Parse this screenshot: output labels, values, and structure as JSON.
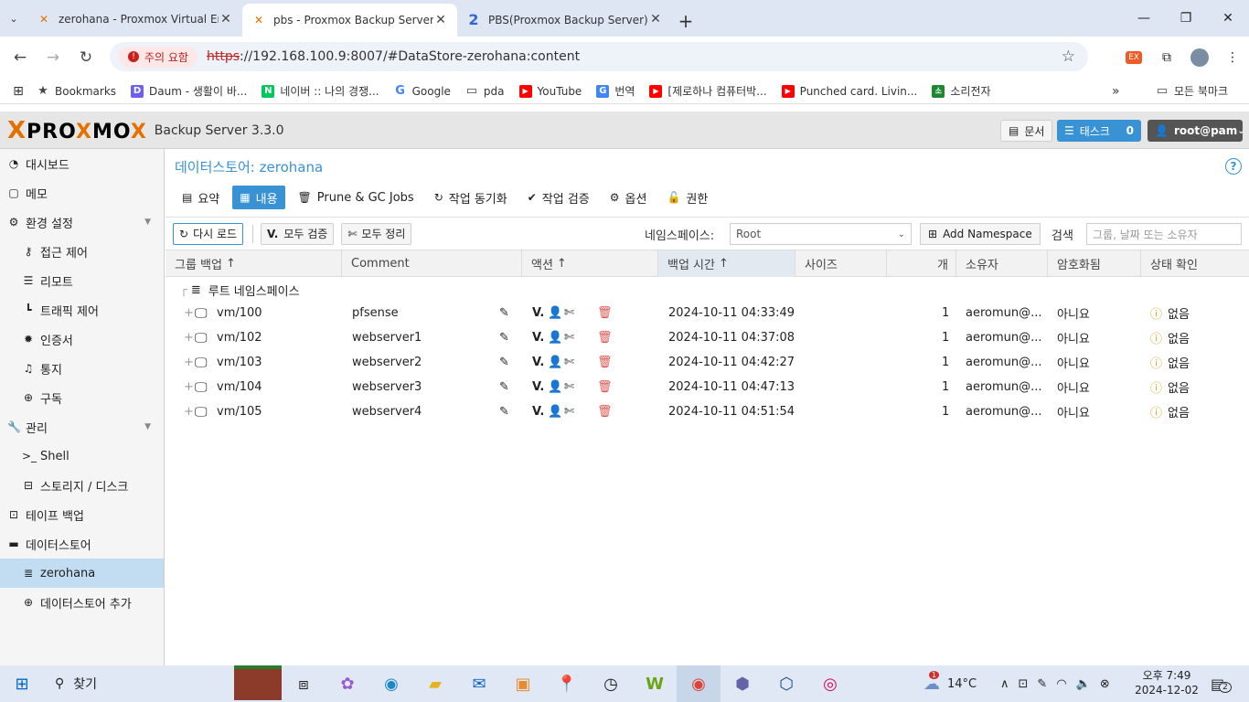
{
  "browser": {
    "tabs": [
      {
        "title": "zerohana - Proxmox Virtual En",
        "active": false
      },
      {
        "title": "pbs - Proxmox Backup Server",
        "active": true
      },
      {
        "title": "PBS(Proxmox Backup Server) 설",
        "active": false
      }
    ],
    "security_warning": "주의 요함",
    "url_scheme": "https",
    "url_rest": "://192.168.100.9:8007/#DataStore-zerohana:content",
    "bookmarks": [
      "Bookmarks",
      "Daum - 생활이 바...",
      "네이버 :: 나의 경쟁...",
      "Google",
      "pda",
      "YouTube",
      "번역",
      "[제로하나 컴퓨터박...",
      "Punched card. Livin...",
      "소리전자"
    ],
    "all_bookmarks": "모든 북마크"
  },
  "app": {
    "logo_left": "PRO",
    "logo_x": "X",
    "logo_mid": "MO",
    "logo_x2": "X",
    "product": "Backup Server 3.3.0",
    "docs_label": "문서",
    "tasks_label": "태스크",
    "tasks_count": "0",
    "user_label": "root@pam"
  },
  "sidebar": {
    "items": [
      {
        "label": "대시보드",
        "icon": "dashboard-icon"
      },
      {
        "label": "메모",
        "icon": "note-icon"
      },
      {
        "label": "환경 설정",
        "icon": "gears-icon"
      },
      {
        "label": "접근 제어",
        "icon": "key-icon"
      },
      {
        "label": "리모트",
        "icon": "server-icon"
      },
      {
        "label": "트래픽 제어",
        "icon": "chart-icon"
      },
      {
        "label": "인증서",
        "icon": "certificate-icon"
      },
      {
        "label": "통지",
        "icon": "bell-icon"
      },
      {
        "label": "구독",
        "icon": "lifering-icon"
      },
      {
        "label": "관리",
        "icon": "wrench-icon"
      },
      {
        "label": "Shell",
        "icon": "terminal-icon"
      },
      {
        "label": "스토리지 / 디스크",
        "icon": "hdd-icon"
      },
      {
        "label": "테이프 백업",
        "icon": "tape-icon"
      },
      {
        "label": "데이터스토어",
        "icon": "archive-icon"
      },
      {
        "label": "zerohana",
        "icon": "database-icon"
      },
      {
        "label": "데이터스토어 추가",
        "icon": "plus-icon"
      }
    ]
  },
  "main": {
    "crumb_prefix": "데이터스토어: ",
    "crumb_name": "zerohana",
    "tabs": [
      "요약",
      "내용",
      "Prune & GC Jobs",
      "작업 동기화",
      "작업 검증",
      "옵션",
      "권한"
    ],
    "toolbar": {
      "reload": "다시 로드",
      "verify_all": "모두 검증",
      "prune_all": "모두 정리",
      "namespace_label": "네임스페이스:",
      "namespace_value": "Root",
      "add_namespace": "Add Namespace",
      "search_label": "검색",
      "search_placeholder": "그룹, 날짜 또는 소유자"
    },
    "columns": [
      "그룹 백업",
      "Comment",
      "액션",
      "백업 시간",
      "사이즈",
      "개",
      "소유자",
      "암호화됨",
      "상태 확인"
    ],
    "root_label": "루트 네임스페이스",
    "rows": [
      {
        "group": "vm/100",
        "comment": "pfsense",
        "time": "2024-10-11 04:33:49",
        "count": "1",
        "owner": "aeromun@...",
        "encrypted": "아니요",
        "status": "없음"
      },
      {
        "group": "vm/102",
        "comment": "webserver1",
        "time": "2024-10-11 04:37:08",
        "count": "1",
        "owner": "aeromun@...",
        "encrypted": "아니요",
        "status": "없음"
      },
      {
        "group": "vm/103",
        "comment": "webserver2",
        "time": "2024-10-11 04:42:27",
        "count": "1",
        "owner": "aeromun@...",
        "encrypted": "아니요",
        "status": "없음"
      },
      {
        "group": "vm/104",
        "comment": "webserver3",
        "time": "2024-10-11 04:47:13",
        "count": "1",
        "owner": "aeromun@...",
        "encrypted": "아니요",
        "status": "없음"
      },
      {
        "group": "vm/105",
        "comment": "webserver4",
        "time": "2024-10-11 04:51:54",
        "count": "1",
        "owner": "aeromun@...",
        "encrypted": "아니요",
        "status": "없음"
      }
    ]
  },
  "taskbar": {
    "search": "찾기",
    "weather": "14°C",
    "weather_badge": "1",
    "time": "오후 7:49",
    "date": "2024-12-02",
    "notif": "2"
  }
}
